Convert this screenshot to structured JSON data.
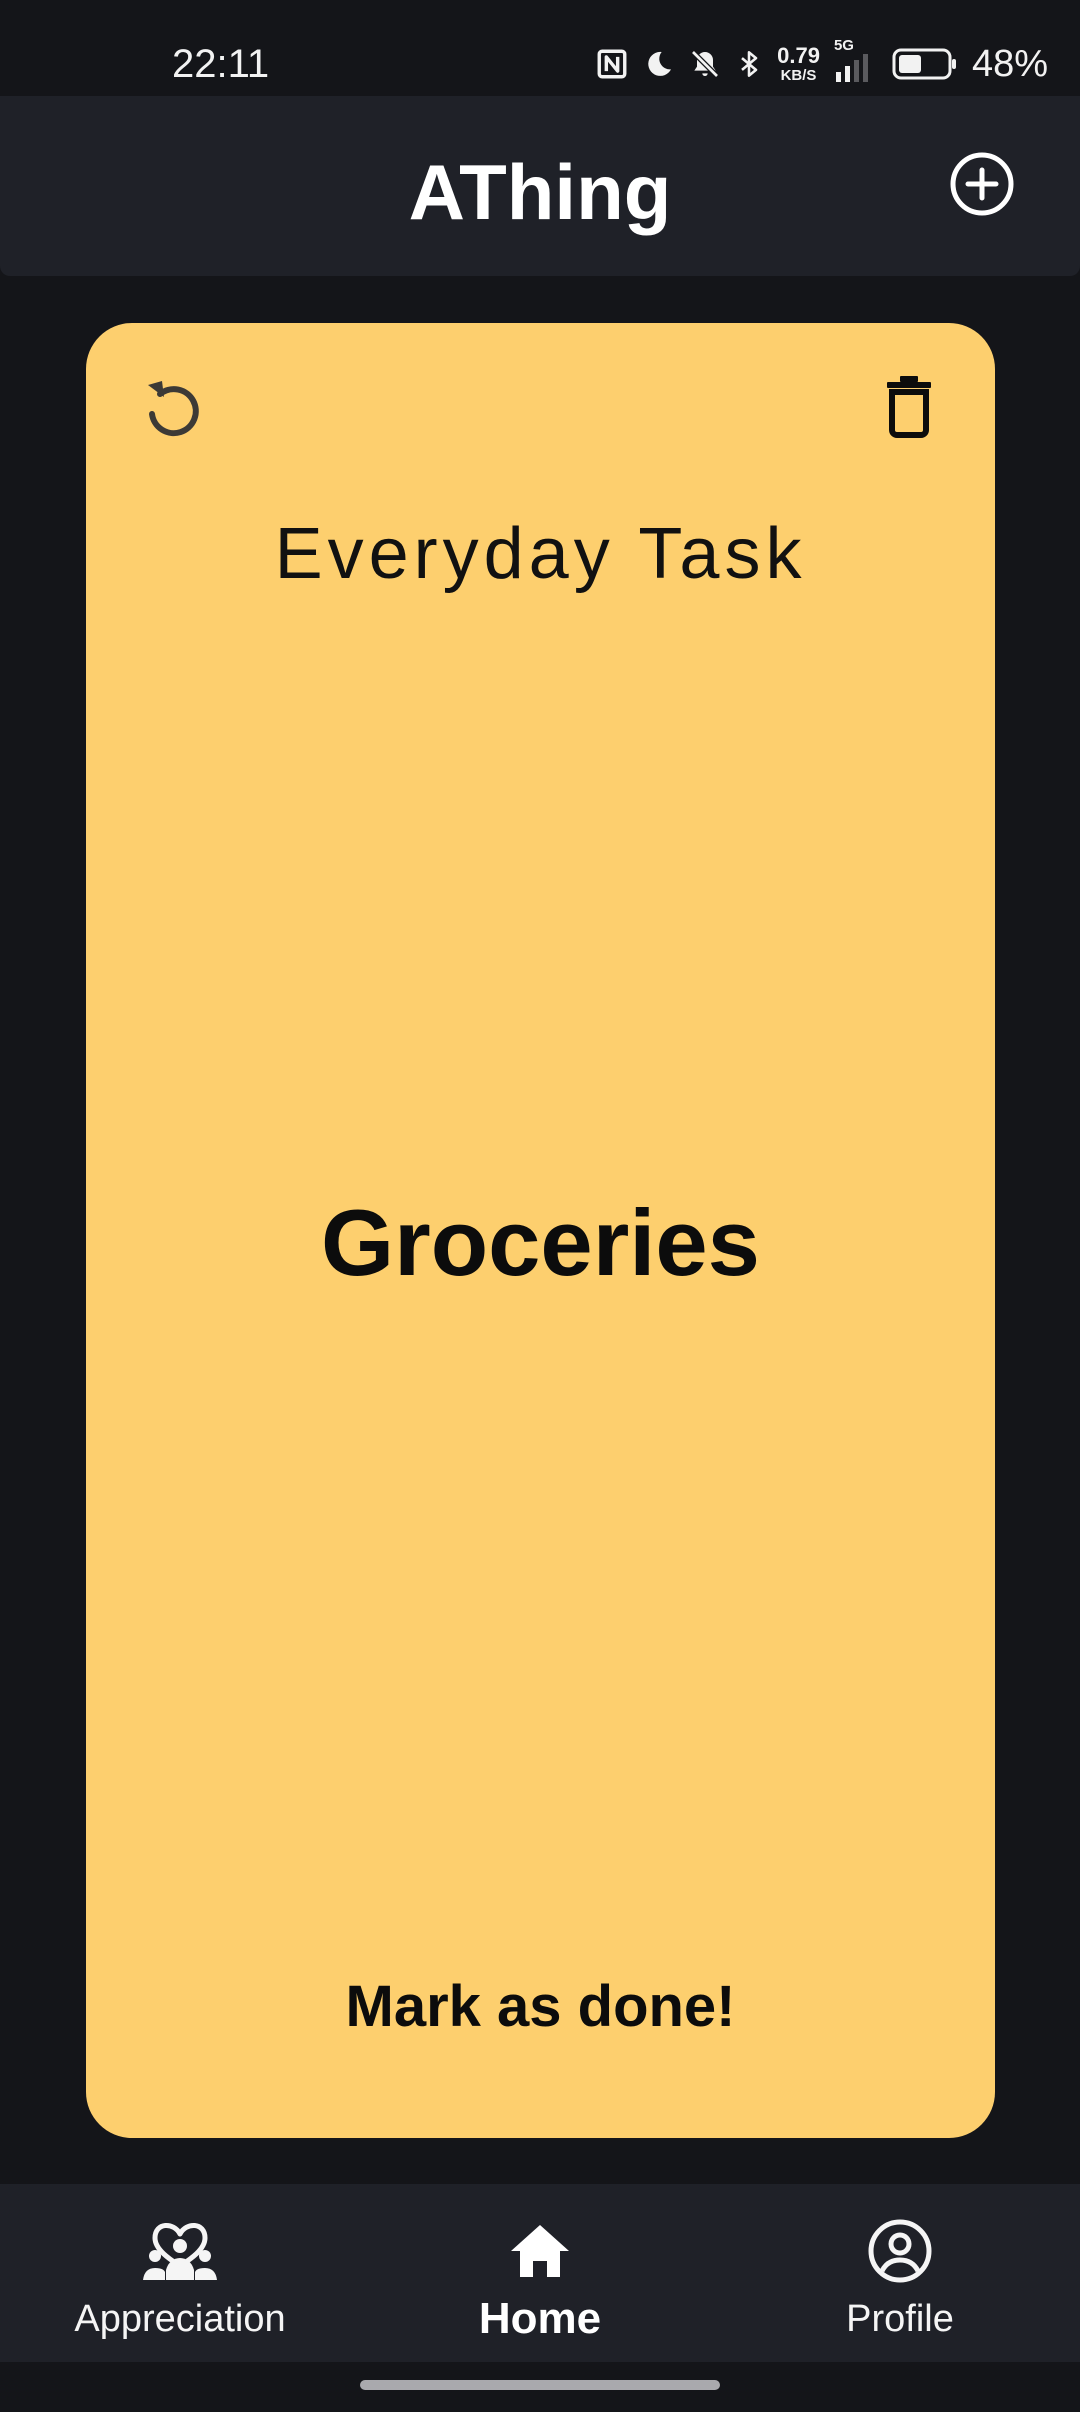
{
  "status_bar": {
    "time": "22:11",
    "net_speed_value": "0.79",
    "net_speed_unit": "KB/S",
    "network_type": "5G",
    "battery_percent": "48%",
    "battery_level": 0.48
  },
  "header": {
    "title": "AThing"
  },
  "card": {
    "category": "Everyday Task",
    "task_name": "Groceries",
    "mark_done_label": "Mark as done!",
    "background_color": "#fdcf6e"
  },
  "bottom_nav": {
    "items": [
      {
        "label": "Appreciation",
        "icon": "people-heart-icon",
        "active": false
      },
      {
        "label": "Home",
        "icon": "home-icon",
        "active": true
      },
      {
        "label": "Profile",
        "icon": "account-circle-icon",
        "active": false
      }
    ]
  },
  "colors": {
    "background": "#141519",
    "surface": "#1f2128",
    "accent_card": "#fdcf6e",
    "text_on_dark": "#ffffff",
    "text_on_card": "#0c0c0c"
  }
}
